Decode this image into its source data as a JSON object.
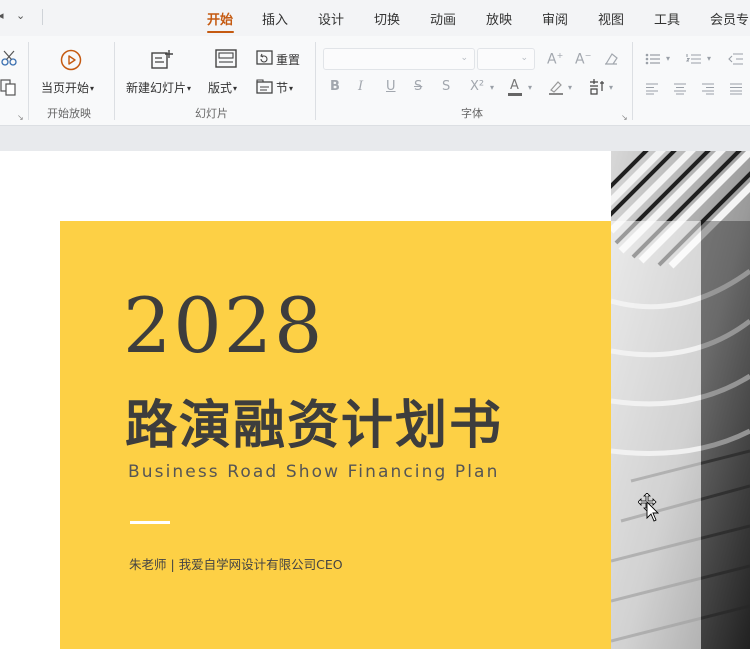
{
  "menubar": {
    "quick_access": {
      "left_arrow": "◂",
      "chevron": "⌄"
    },
    "tabs": [
      {
        "label": "开始",
        "active": true
      },
      {
        "label": "插入",
        "active": false
      },
      {
        "label": "设计",
        "active": false
      },
      {
        "label": "切换",
        "active": false
      },
      {
        "label": "动画",
        "active": false
      },
      {
        "label": "放映",
        "active": false
      },
      {
        "label": "审阅",
        "active": false
      },
      {
        "label": "视图",
        "active": false
      },
      {
        "label": "工具",
        "active": false
      },
      {
        "label": "会员专",
        "active": false
      }
    ],
    "accent_color": "#c55a11"
  },
  "ribbon": {
    "slideshow": {
      "from_current_label": "当页开始",
      "group_label": "开始放映"
    },
    "slides": {
      "new_slide_label": "新建幻灯片",
      "layout_label": "版式",
      "reset_label": "重置",
      "section_label": "节",
      "group_label": "幻灯片"
    },
    "font": {
      "font_name_value": "",
      "font_size_value": "",
      "group_label": "字体",
      "buttons": [
        "B",
        "I",
        "U",
        "S",
        "S",
        "X²",
        "A"
      ]
    },
    "dropdown_glyph": "▾",
    "launcher_glyph": "↘"
  },
  "slide": {
    "year": "2028",
    "title": "路演融资计划书",
    "subtitle": "Business Road Show Financing Plan",
    "presenter": "朱老师 | 我爱自学网设计有限公司CEO",
    "panel_color": "#fdd045",
    "text_color": "#3d3d3d"
  }
}
